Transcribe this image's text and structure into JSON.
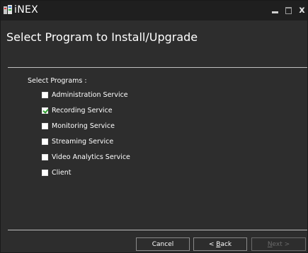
{
  "window": {
    "title": "iNEX",
    "icon": "app-icon",
    "controls": {
      "minimize": "minimize-icon",
      "maximize": "maximize-icon",
      "close": "x"
    }
  },
  "header": {
    "title": "Select Program to Install/Upgrade"
  },
  "programs": {
    "label": "Select Programs :",
    "items": [
      {
        "label": "Administration Service",
        "checked": false
      },
      {
        "label": "Recording Service",
        "checked": true
      },
      {
        "label": "Monitoring Service",
        "checked": false
      },
      {
        "label": "Streaming Service",
        "checked": false
      },
      {
        "label": "Video Analytics Service",
        "checked": false
      },
      {
        "label": "Client",
        "checked": false
      }
    ]
  },
  "buttons": {
    "cancel": "Cancel",
    "back_prefix": "< ",
    "back_mnemonic": "B",
    "back_rest": "ack",
    "next_mnemonic": "N",
    "next_rest": "ext >",
    "next_enabled": false
  },
  "colors": {
    "background": "#2d2d2d",
    "titlebar": "#1f1f1f",
    "check": "#2e9d2e",
    "disabled_text": "#6a6a6a"
  }
}
